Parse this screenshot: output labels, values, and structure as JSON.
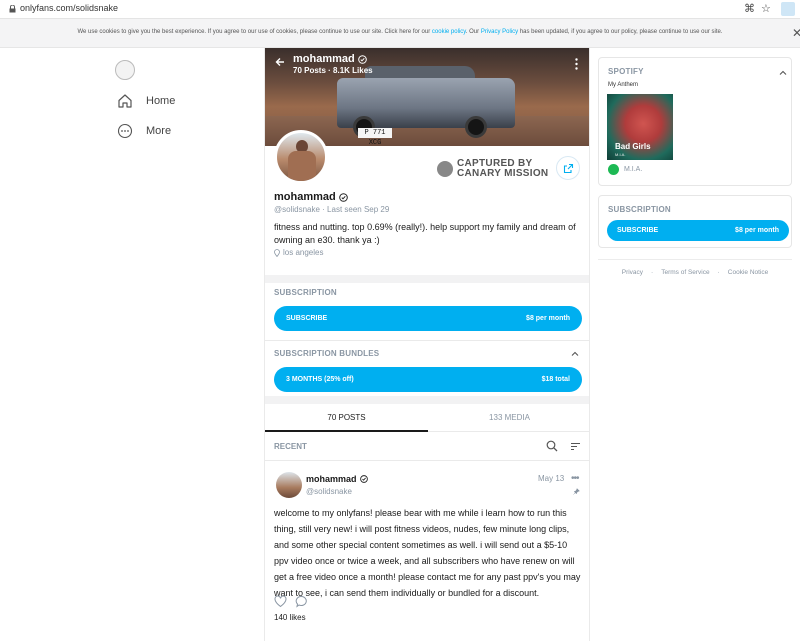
{
  "browser": {
    "url": "onlyfans.com/solidsnake"
  },
  "cookie_banner": {
    "text_1": "We use cookies to give you the best experience. If you agree to our use of cookies, please continue to use our site. Click here for our",
    "link_1": "cookie policy",
    "text_2": ". Our",
    "link_2": "Privacy Policy",
    "text_3": "has been updated, if you agree to our policy, please continue to use our site."
  },
  "left_nav": {
    "home_label": "Home",
    "more_label": "More"
  },
  "profile": {
    "cover_name": "mohammad",
    "posts_count": "70 Posts",
    "likes_count": "8.1K Likes",
    "plate": "P 771 XCG",
    "canary_line1": "CAPTURED BY",
    "canary_line2": "CANARY MISSION",
    "name": "mohammad",
    "handle": "@solidsnake",
    "last_seen": "Last seen Sep 29",
    "bio": "fitness and nutting. top 0.69% (really!). help support my family and dream of owning an e30. thank ya :)",
    "location": "los angeles"
  },
  "subscription": {
    "title": "SUBSCRIPTION",
    "button_label": "SUBSCRIBE",
    "price": "$8 per month"
  },
  "bundles": {
    "title": "SUBSCRIPTION BUNDLES",
    "bundle_label": "3 MONTHS (25% off)",
    "bundle_price": "$18 total"
  },
  "tabs": {
    "posts": "70 POSTS",
    "media": "133 MEDIA"
  },
  "feed": {
    "section_label": "RECENT"
  },
  "post": {
    "author": "mohammad",
    "handle": "@solidsnake",
    "date": "May 13",
    "text": "welcome to my onlyfans! please bear with me while i learn how to run this thing, still very new! i will post fitness videos, nudes, few minute long clips, and some other special content sometimes as well. i will send out a $5-10 ppv video once or twice a week, and all subscribers who have renew on will get a free video once a month! please contact me for any past ppv's you may want to see, i can send them individually or bundled for a discount.",
    "likes": "140 likes"
  },
  "spotify": {
    "title": "SPOTIFY",
    "subtitle": "My Anthem",
    "album_title": "Bad Girls",
    "album_sub": "M.I.A.",
    "artist": "M.I.A."
  },
  "right_subscription": {
    "title": "SUBSCRIPTION",
    "button_label": "SUBSCRIBE",
    "price": "$8 per month"
  },
  "footer": {
    "privacy": "Privacy",
    "terms": "Terms of Service",
    "cookie": "Cookie Notice",
    "sep": "·"
  },
  "colors": {
    "accent": "#00aff0",
    "muted": "#8a96a3",
    "spotify_green": "#1db954"
  }
}
